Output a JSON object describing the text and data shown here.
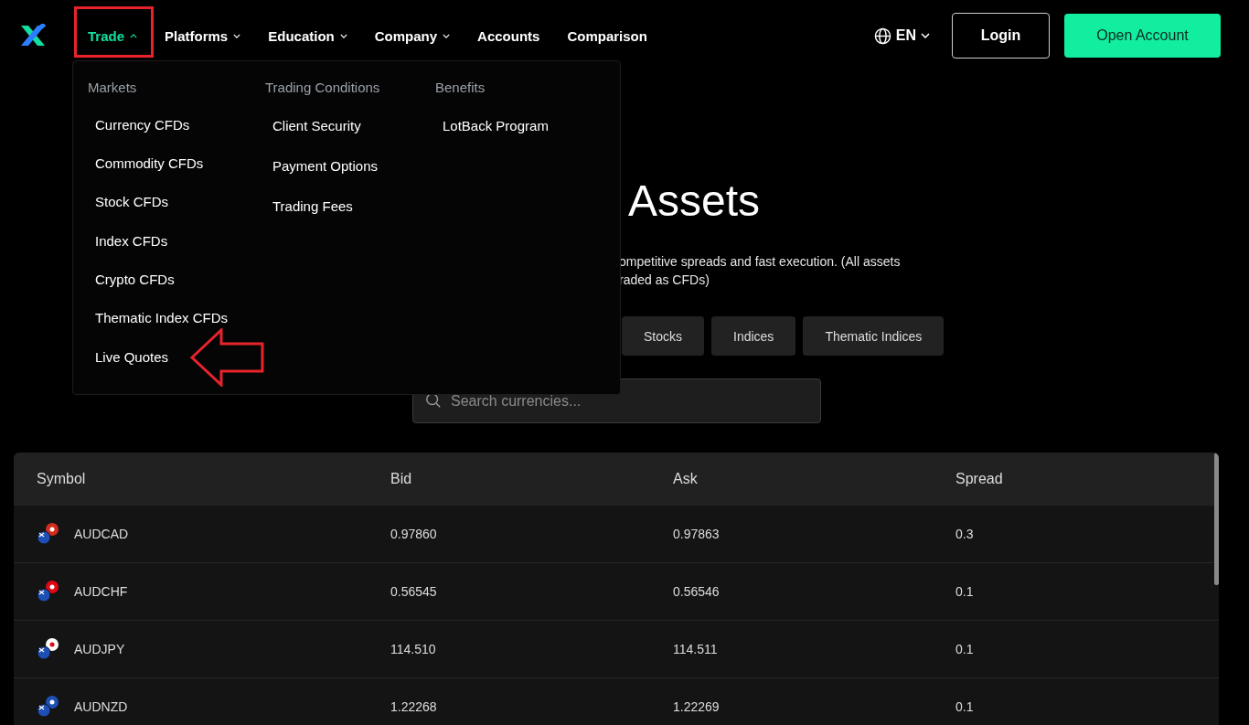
{
  "nav": {
    "items": [
      {
        "label": "Trade",
        "selected": true,
        "expanded": true
      },
      {
        "label": "Platforms",
        "selected": false,
        "expanded": false
      },
      {
        "label": "Education",
        "selected": false,
        "expanded": false
      },
      {
        "label": "Company",
        "selected": false,
        "expanded": false
      },
      {
        "label": "Accounts",
        "selected": false
      },
      {
        "label": "Comparison",
        "selected": false
      }
    ],
    "language": "EN",
    "login": "Login",
    "open_account": "Open Account"
  },
  "menu": {
    "columns": [
      {
        "heading": "Markets",
        "items": [
          "Currency CFDs",
          "Commodity CFDs",
          "Stock CFDs",
          "Index CFDs",
          "Crypto CFDs",
          "Thematic Index CFDs",
          "Live Quotes"
        ]
      },
      {
        "heading": "Trading Conditions",
        "items": [
          "Client Security",
          "Payment Options",
          "Trading Fees"
        ]
      },
      {
        "heading": "Benefits",
        "items": [
          "LotBack Program"
        ]
      }
    ]
  },
  "hero": {
    "title": "Assets",
    "subtitle_lines": [
      "ompetitive spreads and fast execution. (All assets",
      "raded as CFDs)"
    ],
    "filters": [
      {
        "label": "Stocks",
        "selected": false
      },
      {
        "label": "Indices",
        "selected": false
      },
      {
        "label": "Thematic Indices",
        "selected": false
      }
    ],
    "search": {
      "placeholder": "Search currencies..."
    }
  },
  "table": {
    "columns": [
      "Symbol",
      "Bid",
      "Ask",
      "Spread"
    ],
    "rows": [
      [
        "AUDCAD",
        "0.97860",
        "0.97863",
        "0.3"
      ],
      [
        "AUDCHF",
        "0.56545",
        "0.56546",
        "0.1"
      ],
      [
        "AUDJPY",
        "114.510",
        "114.511",
        "0.1"
      ],
      [
        "AUDNZD",
        "1.22268",
        "1.22269",
        "0.1"
      ]
    ]
  }
}
